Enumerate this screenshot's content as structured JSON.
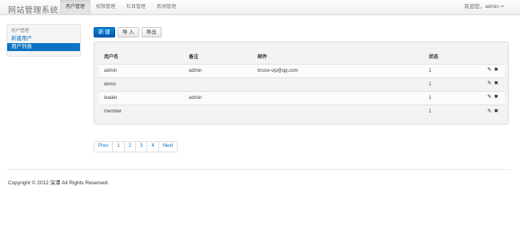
{
  "navbar": {
    "brand": "网站管理系统",
    "items": [
      {
        "label": "用户管理",
        "active": true
      },
      {
        "label": "权限管理",
        "active": false
      },
      {
        "label": "栏目管理",
        "active": false
      },
      {
        "label": "新闻管理",
        "active": false
      }
    ],
    "user_menu": "欢迎您，admin"
  },
  "sidebar": {
    "header": "用户管理",
    "links": [
      {
        "label": "新建用户",
        "active": false
      },
      {
        "label": "用户列表",
        "active": true
      }
    ]
  },
  "toolbar": {
    "new_label": "新 建",
    "import_label": "导 入",
    "export_label": "导出"
  },
  "table": {
    "headers": [
      "用户名",
      "备注",
      "邮件",
      "状态"
    ],
    "rows": [
      {
        "username": "admin",
        "note": "admin",
        "email": "bruce-vip@qq.com",
        "status": "1"
      },
      {
        "username": "demo",
        "note": "",
        "email": "",
        "status": "1"
      },
      {
        "username": "leader",
        "note": "admin",
        "email": "",
        "status": "1"
      },
      {
        "username": "member",
        "note": "",
        "email": "",
        "status": "1"
      }
    ],
    "edit_icon": "pencil-icon",
    "delete_icon": "close-icon"
  },
  "pagination": {
    "prev": "Prev",
    "pages": [
      "1",
      "2",
      "3",
      "4"
    ],
    "next": "Next"
  },
  "footer": {
    "copyright": "Copyright © 2012 深潭 All Rights Reserved."
  },
  "colors": {
    "primary": "#0a73c2",
    "link": "#0a6fbe"
  }
}
